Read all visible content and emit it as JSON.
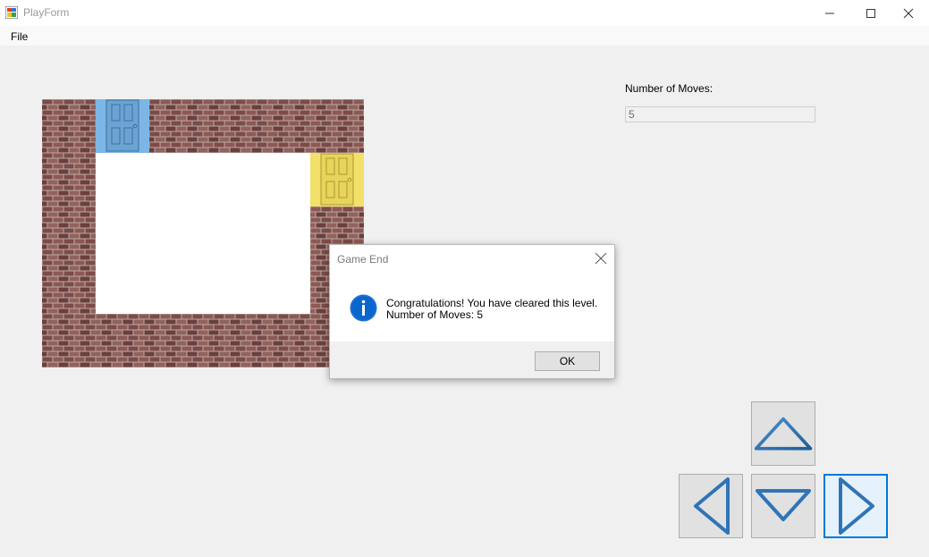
{
  "window": {
    "title": "PlayForm",
    "controls": [
      "minimize-icon",
      "maximize-icon",
      "close-icon"
    ]
  },
  "menu": {
    "items": [
      "File"
    ]
  },
  "game": {
    "board": {
      "wall_style": "brick",
      "doors": [
        {
          "name": "blue-door",
          "color": "#7cb6e6"
        },
        {
          "name": "yellow-door",
          "color": "#f1e06a"
        }
      ]
    },
    "moves_label": "Number of Moves:",
    "moves_value": "5",
    "arrow_buttons": [
      "up-arrow-icon",
      "left-arrow-icon",
      "down-arrow-icon",
      "right-arrow-icon"
    ]
  },
  "dialog": {
    "title": "Game End",
    "icon": "info-icon",
    "message_line1": "Congratulations! You have cleared this level.",
    "message_line2": "Number of Moves: 5",
    "ok_label": "OK"
  },
  "colors": {
    "accent": "#0078d7",
    "brick": "#7c4b48",
    "mortar": "#b9aaa6",
    "arrow": "#2f74b7"
  }
}
